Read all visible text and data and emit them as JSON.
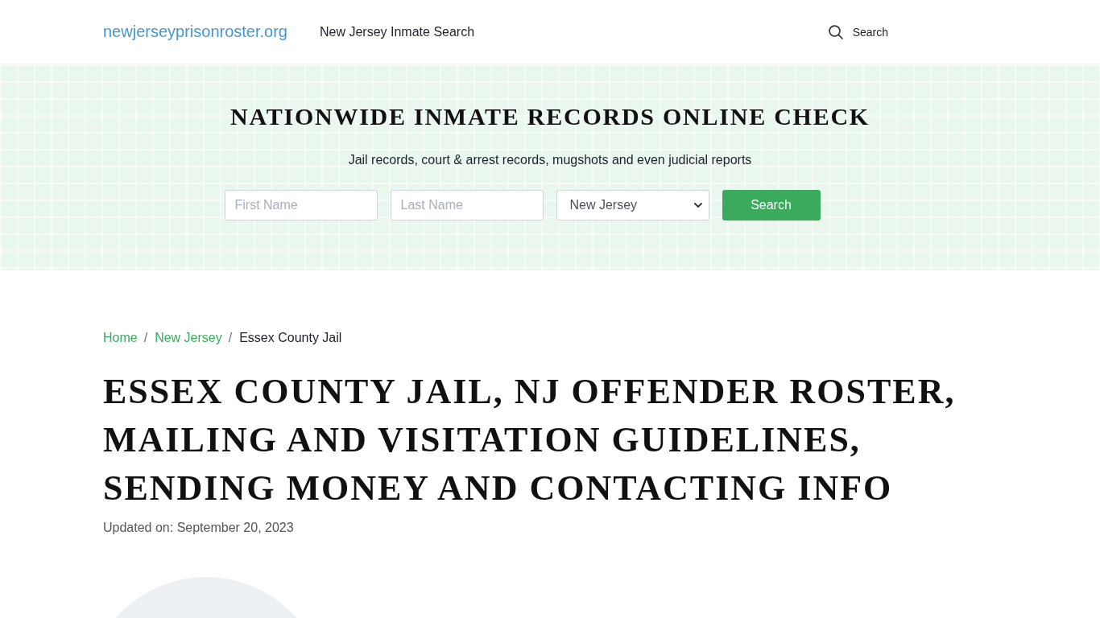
{
  "header": {
    "site_name": "newjerseyprisonroster.org",
    "nav_link": "New Jersey Inmate Search",
    "search_button": "Search"
  },
  "hero": {
    "title": "NATIONWIDE INMATE RECORDS ONLINE CHECK",
    "subtitle": "Jail records, court & arrest records, mugshots and even judicial reports",
    "search_form": {
      "first_name": {
        "placeholder": "First Name"
      },
      "last_name": {
        "placeholder": "Last Name"
      },
      "state_select": {
        "value": "New Jersey"
      },
      "submit_button": "Search"
    }
  },
  "breadcrumb": [
    {
      "label": "Home",
      "kind": "link",
      "separator": "/"
    },
    {
      "label": "New Jersey",
      "kind": "link",
      "separator": "/"
    },
    {
      "label": "Essex County Jail",
      "kind": "current"
    }
  ],
  "article": {
    "title": "ESSEX COUNTY JAIL, NJ OFFENDER ROSTER, MAILING AND VISITATION GUIDELINES, SENDING MONEY AND CONTACTING INFO",
    "updated": "Updated on: September 20, 2023"
  }
}
